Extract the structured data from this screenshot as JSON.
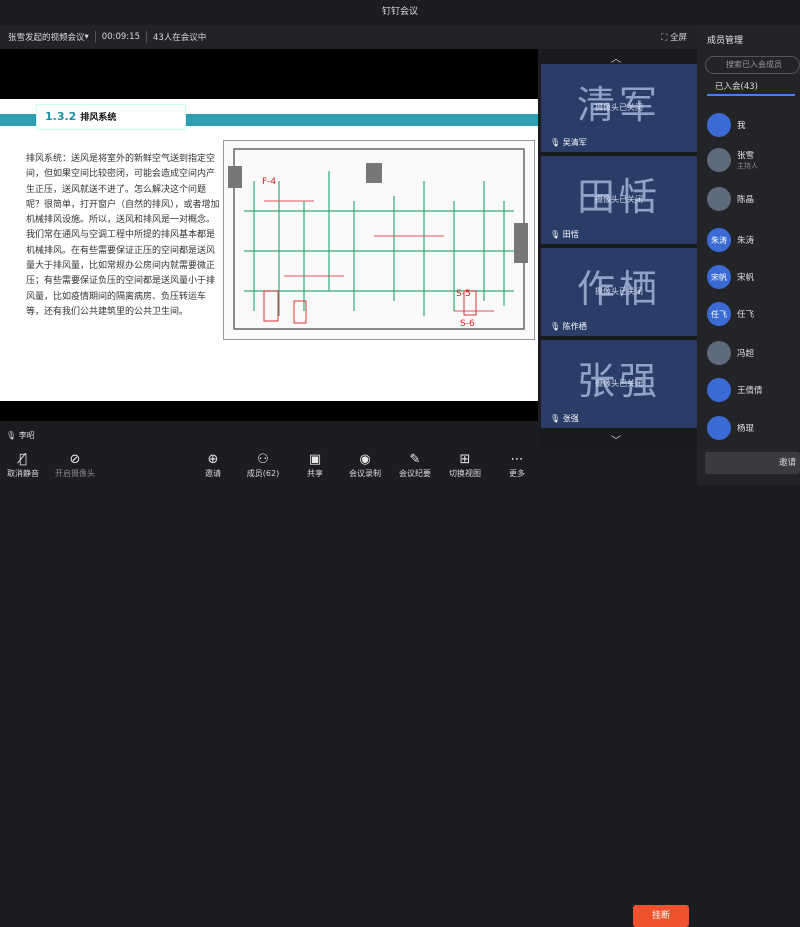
{
  "window_title": "钉钉会议",
  "meeting": {
    "title": "张雪发起的视频会议",
    "duration": "00:09:15",
    "attendees": "43人在会议中",
    "fullscreen": "全屏"
  },
  "slide": {
    "heading_num": "1.3.2",
    "heading": "排风系统",
    "body": "排风系统：送风是将室外的新鲜空气送到指定空间，但如果空间比较密闭，可能会造成空间内产生正压，送风就送不进了。怎么解决这个问题呢？很简单，打开窗户（自然的排风），或者增加机械排风设施。所以，送风和排风是一对概念。我们常在通风与空调工程中所提的排风基本都是机械排风。在有些需要保证正压的空间都是送风量大于排风量，比如常规办公房间内就需要微正压；有些需要保证负压的空间都是送风量小于排风量，比如疫情期间的隔离病房、负压转运车等，还有我们公共建筑里的公共卫生间。",
    "plan_labels": [
      "F-4",
      "S-5",
      "S-6"
    ]
  },
  "speaker": "李昭",
  "tiles": [
    {
      "big": "清军",
      "cam": "摄像头已关闭",
      "name": "吴清军"
    },
    {
      "big": "田恬",
      "cam": "摄像头已关闭",
      "name": "田恬"
    },
    {
      "big": "作栖",
      "cam": "摄像头已关闭",
      "name": "陈作栖"
    },
    {
      "big": "张强",
      "cam": "摄像头已关闭",
      "name": "张强"
    }
  ],
  "panel": {
    "title": "成员管理",
    "search_placeholder": "搜索已入会成员",
    "tab": "已入会(43)",
    "invite": "邀请",
    "members": [
      {
        "avatar": "",
        "name": "我",
        "role": ""
      },
      {
        "avatar": "",
        "name": "张雪",
        "role": "主持人"
      },
      {
        "avatar": "",
        "name": "陈晶",
        "role": ""
      },
      {
        "avatar": "朱涛",
        "name": "朱涛",
        "role": ""
      },
      {
        "avatar": "宋帆",
        "name": "宋帆",
        "role": ""
      },
      {
        "avatar": "任飞",
        "name": "任飞",
        "role": ""
      },
      {
        "avatar": "",
        "name": "冯超",
        "role": ""
      },
      {
        "avatar": "",
        "name": "王倩倩",
        "role": ""
      },
      {
        "avatar": "",
        "name": "杨琨",
        "role": ""
      }
    ]
  },
  "toolbar": {
    "mute": "取消静音",
    "camera": "开启摄像头",
    "invite": "邀请",
    "members": "成员(62)",
    "share": "共享",
    "record": "会议录制",
    "minutes": "会议纪要",
    "view": "切换视图",
    "more": "更多",
    "end": "挂断"
  },
  "colors": {
    "accent": "#2d9fae",
    "tile": "#2a3d68",
    "end": "#f0512e"
  }
}
